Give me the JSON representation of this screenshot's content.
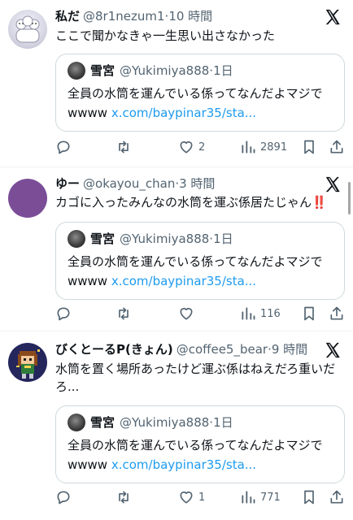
{
  "posts": [
    {
      "name": "私だ",
      "handle": "@8r1nezum1",
      "time": "10 時間",
      "text": "ここで聞かなきゃ一生思い出さなかった",
      "quote": {
        "name": "雪宮",
        "handle": "@Yukimiya888",
        "time": "1日",
        "text": "全員の水筒を運んでいる係ってなんだよマジで",
        "prefix": "wwww",
        "link": "x.com/baypinar35/sta..."
      },
      "likes": "2",
      "views": "2891"
    },
    {
      "name": "ゆー",
      "handle": "@okayou_chan",
      "time": "3 時間",
      "text": "カゴに入ったみんなの水筒を運ぶ係居たじゃん",
      "emoji": "‼️",
      "quote": {
        "name": "雪宮",
        "handle": "@Yukimiya888",
        "time": "1日",
        "text": "全員の水筒を運んでいる係ってなんだよマジで",
        "prefix": "wwww",
        "link": "x.com/baypinar35/sta..."
      },
      "likes": "",
      "views": "116"
    },
    {
      "name": "びくとーるP(きょん)",
      "handle": "@coffee5_bear",
      "time": "9 時間",
      "text": "水筒を置く場所あったけど運ぶ係はねえだろ重いだろ...",
      "quote": {
        "name": "雪宮",
        "handle": "@Yukimiya888",
        "time": "1日",
        "text": "全員の水筒を運んでいる係ってなんだよマジで",
        "prefix": "wwww",
        "link": "x.com/baypinar35/sta..."
      },
      "likes": "1",
      "views": "771"
    }
  ],
  "icons": {
    "reply": "reply-icon",
    "repost": "repost-icon",
    "like": "heart-icon",
    "views": "views-icon",
    "bookmark": "bookmark-icon",
    "share": "share-icon",
    "logo": "x-logo-icon"
  },
  "colors": {
    "text": "#0f1419",
    "secondary": "#536471",
    "link": "#1d9bf0",
    "border": "#cfd9de",
    "emoji": "#e0245e"
  }
}
